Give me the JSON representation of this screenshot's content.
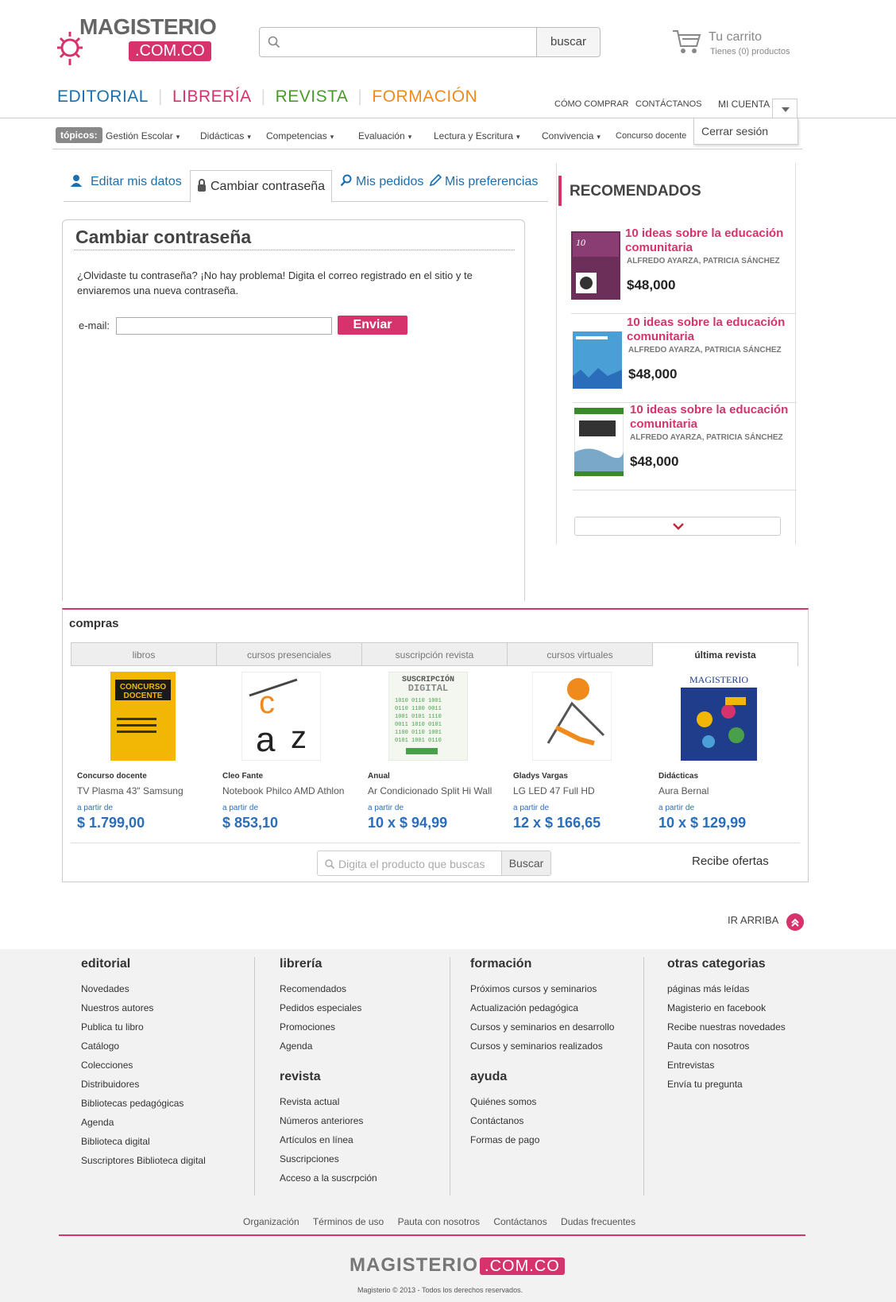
{
  "header": {
    "logo_text": "MAGISTERIO",
    "logo_sub": ".COM.CO",
    "search_placeholder": "",
    "search_button": "buscar",
    "cart_title": "Tu carrito",
    "cart_sub": "Tienes (0) productos"
  },
  "mainnav": [
    {
      "label": "EDITORIAL",
      "color": "#1a6fb0"
    },
    {
      "label": "LIBRERÍA",
      "color": "#d6336c"
    },
    {
      "label": "REVISTA",
      "color": "#4a9a2a"
    },
    {
      "label": "FORMACIÓN",
      "color": "#f08a1c"
    }
  ],
  "toplinks": {
    "como_comprar": "CÓMO COMPRAR",
    "contactanos": "CONTÁCTANOS",
    "mi_cuenta": "MI CUENTA"
  },
  "account_menu": {
    "logout": "Cerrar sesión"
  },
  "topics": {
    "badge": "tópicos:",
    "items": [
      "Gestión Escolar",
      "Didácticas",
      "Competencias",
      "Evaluación",
      "Lectura y Escritura",
      "Convivencia",
      "Concurso docente"
    ]
  },
  "account_tabs": [
    "Editar mis datos",
    "Cambiar contraseña",
    "Mis pedidos",
    "Mis preferencias"
  ],
  "password_panel": {
    "title": "Cambiar contraseña",
    "description": "¿Olvidaste tu contraseña? ¡No hay problema! Digita el correo registrado en el sitio y te enviaremos una nueva contraseña.",
    "email_label": "e-mail:",
    "email_value": "",
    "send_button": "Enviar"
  },
  "recommended": {
    "title": "RECOMENDADOS",
    "items": [
      {
        "name": "10 ideas sobre la educación comunitaria",
        "author": "ALFREDO AYARZA, PATRICIA SÁNCHEZ",
        "price": "$48,000"
      },
      {
        "name": "10 ideas sobre la educación comunitaria",
        "author": "ALFREDO AYARZA, PATRICIA SÁNCHEZ",
        "price": "$48,000"
      },
      {
        "name": "10 ideas sobre la educación comunitaria",
        "author": "ALFREDO AYARZA, PATRICIA SÁNCHEZ",
        "price": "$48,000"
      }
    ]
  },
  "compras": {
    "title": "compras",
    "tabs": [
      "libros",
      "cursos presenciales",
      "suscripción revista",
      "cursos virtuales",
      "última revista"
    ],
    "products": [
      {
        "category": "Concurso docente",
        "name": "TV Plasma 43\" Samsung",
        "from": "a partir de",
        "price": "$ 1.799,00"
      },
      {
        "category": "Cleo Fante",
        "name": "Notebook Philco AMD Athlon",
        "from": "a partir de",
        "price": "$ 853,10"
      },
      {
        "category": "Anual",
        "name": "Ar Condicionado Split Hi Wall",
        "from": "a partir de",
        "price": "10 x $ 94,99"
      },
      {
        "category": "Gladys Vargas",
        "name": "LG LED 47 Full HD",
        "from": "a partir de",
        "price": "12 x $ 166,65"
      },
      {
        "category": "Didácticas",
        "name": "Aura Bernal",
        "from": "a partir de",
        "price": "10 x $ 129,99"
      }
    ],
    "search_placeholder": "Digita el producto que buscas",
    "search_button": "Buscar",
    "offers": "Recibe ofertas"
  },
  "ir_arriba": "IR ARRIBA",
  "footer": {
    "editorial": {
      "title": "editorial",
      "links": [
        "Novedades",
        "Nuestros autores",
        "Publica tu libro",
        "Catálogo",
        "Colecciones",
        "Distribuidores",
        "Bibliotecas pedagógicas",
        "Agenda",
        "Biblioteca digital",
        "Suscriptores Biblioteca digital"
      ]
    },
    "libreria": {
      "title": "librería",
      "links": [
        "Recomendados",
        "Pedidos especiales",
        "Promociones",
        "Agenda"
      ]
    },
    "revista": {
      "title": "revista",
      "links": [
        "Revista actual",
        "Números anteriores",
        "Artículos en línea",
        "Suscripciones",
        "Acceso a la suscrpción"
      ]
    },
    "formacion": {
      "title": "formación",
      "links": [
        "Próximos cursos y seminarios",
        "Actualización pedagógica",
        "Cursos y seminarios en desarrollo",
        "Cursos y seminarios realizados"
      ]
    },
    "ayuda": {
      "title": "ayuda",
      "links": [
        "Quiénes somos",
        "Contáctanos",
        "Formas de pago"
      ]
    },
    "otras": {
      "title": "otras categorias",
      "links": [
        "páginas más leídas",
        "Magisterio en facebook",
        "Recibe nuestras novedades",
        "Pauta con nosotros",
        "Entrevistas",
        "Envía tu pregunta"
      ]
    },
    "bottom_links": [
      "Organización",
      "Términos de uso",
      "Pauta con nosotros",
      "Contáctanos",
      "Dudas frecuentes"
    ],
    "logo_text": "MAGISTERIO",
    "logo_sub": ".COM.CO",
    "copyright": "Magisterio © 2013 - Todos los derechos reservados."
  }
}
